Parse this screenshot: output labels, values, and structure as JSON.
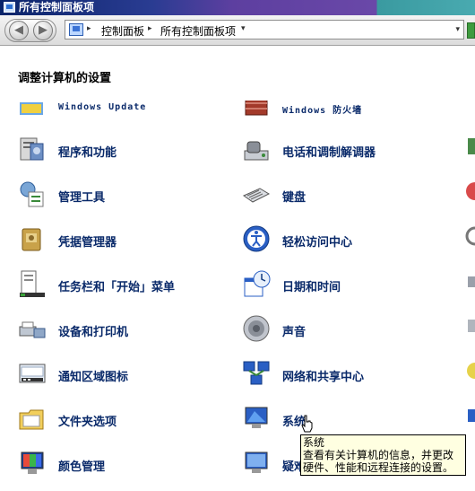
{
  "window": {
    "title": "所有控制面板项"
  },
  "address": {
    "segments": [
      "控制面板",
      "所有控制面板项"
    ]
  },
  "content": {
    "heading": "调整计算机的设置",
    "left_items": [
      {
        "label": "Windows Update",
        "icon": "windows-update-icon"
      },
      {
        "label": "程序和功能",
        "icon": "programs-features-icon"
      },
      {
        "label": "管理工具",
        "icon": "admin-tools-icon"
      },
      {
        "label": "凭据管理器",
        "icon": "credential-manager-icon"
      },
      {
        "label": "任务栏和「开始」菜单",
        "icon": "taskbar-start-icon"
      },
      {
        "label": "设备和打印机",
        "icon": "devices-printers-icon"
      },
      {
        "label": "通知区域图标",
        "icon": "notification-area-icon"
      },
      {
        "label": "文件夹选项",
        "icon": "folder-options-icon"
      },
      {
        "label": "颜色管理",
        "icon": "color-management-icon"
      }
    ],
    "right_items": [
      {
        "label": "Windows 防火墙",
        "icon": "firewall-icon"
      },
      {
        "label": "电话和调制解调器",
        "icon": "phone-modem-icon"
      },
      {
        "label": "键盘",
        "icon": "keyboard-icon"
      },
      {
        "label": "轻松访问中心",
        "icon": "ease-of-access-icon"
      },
      {
        "label": "日期和时间",
        "icon": "date-time-icon"
      },
      {
        "label": "声音",
        "icon": "sound-icon"
      },
      {
        "label": "网络和共享中心",
        "icon": "network-sharing-icon"
      },
      {
        "label": "系统",
        "icon": "system-icon"
      },
      {
        "label": "疑难",
        "icon": "troubleshooting-icon"
      }
    ]
  },
  "tooltip": {
    "title": "系统",
    "body": "查看有关计算机的信息，并更改硬件、性能和远程连接的设置。"
  },
  "colors": {
    "link": "#0a2a6a",
    "titlebar": "#0a246a",
    "tooltip_bg": "#ffffe1"
  }
}
